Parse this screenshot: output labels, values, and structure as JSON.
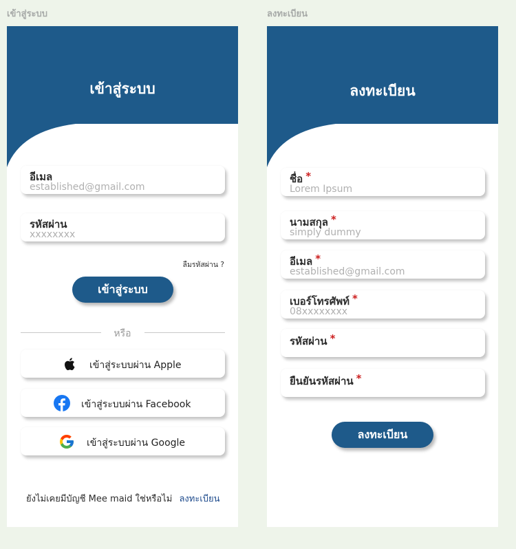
{
  "frames": {
    "login_label": "เข้าสู่ระบบ",
    "register_label": "ลงทะเบียน"
  },
  "colors": {
    "brand": "#1e5a8a",
    "required": "#cc1f1f",
    "link": "#1d4a8c",
    "background": "#eef4ea"
  },
  "login": {
    "title": "เข้าสู่ระบบ",
    "email": {
      "label": "อีเมล",
      "value": "established@gmail.com"
    },
    "password": {
      "label": "รหัสผ่าน",
      "value": "xxxxxxxx"
    },
    "forgot_password": "ลืมรหัสผ่าน ?",
    "submit_label": "เข้าสู่ระบบ",
    "or_text": "หรือ",
    "social": [
      {
        "icon": "apple-icon",
        "label": "เข้าสู่ระบบผ่าน Apple"
      },
      {
        "icon": "facebook-icon",
        "label": "เข้าสู่ระบบผ่าน Facebook"
      },
      {
        "icon": "google-icon",
        "label": "เข้าสู่ระบบผ่าน Google"
      }
    ],
    "signup_prompt": "ยังไม่เคยมีบัญชี Mee maid ใช่หรือไม่",
    "signup_link": "ลงทะเบียน"
  },
  "register": {
    "title": "ลงทะเบียน",
    "required_mark": "*",
    "fields": [
      {
        "label": "ชื่อ",
        "value": "Lorem Ipsum"
      },
      {
        "label": "นามสกุล",
        "value": "simply dummy"
      },
      {
        "label": "อีเมล",
        "value": "established@gmail.com"
      },
      {
        "label": "เบอร์โทรศัพท์",
        "value": "08xxxxxxxx"
      },
      {
        "label": "รหัสผ่าน",
        "value": ""
      },
      {
        "label": "ยืนยันรหัสผ่าน",
        "value": ""
      }
    ],
    "submit_label": "ลงทะเบียน"
  }
}
